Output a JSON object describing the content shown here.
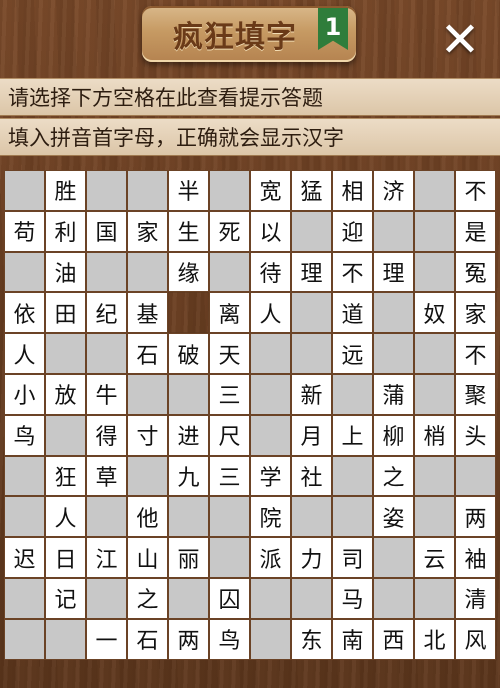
{
  "header": {
    "title": "疯狂填字",
    "level": "1",
    "close_icon": "close-icon"
  },
  "hints": {
    "line1": "请选择下方空格在此查看提示答题",
    "line2": "填入拼音首字母，正确就会显示汉字"
  },
  "grid": {
    "cols": 12,
    "legend": "E = no cell (wood), B = blank input cell (gray), other = filled character",
    "rows": [
      [
        "B",
        "胜",
        "B",
        "B",
        "半",
        "B",
        "宽",
        "猛",
        "相",
        "济",
        "B",
        "不"
      ],
      [
        "苟",
        "利",
        "国",
        "家",
        "生",
        "死",
        "以",
        "B",
        "迎",
        "B",
        "B",
        "是"
      ],
      [
        "B",
        "油",
        "B",
        "B",
        "缘",
        "B",
        "待",
        "理",
        "不",
        "理",
        "B",
        "冤"
      ],
      [
        "依",
        "田",
        "纪",
        "基",
        "E",
        "离",
        "人",
        "B",
        "道",
        "B",
        "奴",
        "家"
      ],
      [
        "人",
        "B",
        "B",
        "石",
        "破",
        "天",
        "B",
        "B",
        "远",
        "B",
        "B",
        "不"
      ],
      [
        "小",
        "放",
        "牛",
        "B",
        "B",
        "三",
        "B",
        "新",
        "B",
        "蒲",
        "B",
        "聚"
      ],
      [
        "鸟",
        "B",
        "得",
        "寸",
        "进",
        "尺",
        "B",
        "月",
        "上",
        "柳",
        "梢",
        "头"
      ],
      [
        "B",
        "狂",
        "草",
        "B",
        "九",
        "三",
        "学",
        "社",
        "B",
        "之",
        "B",
        "B"
      ],
      [
        "B",
        "人",
        "B",
        "他",
        "B",
        "B",
        "院",
        "B",
        "B",
        "姿",
        "B",
        "两"
      ],
      [
        "迟",
        "日",
        "江",
        "山",
        "丽",
        "B",
        "派",
        "力",
        "司",
        "B",
        "云",
        "袖"
      ],
      [
        "B",
        "记",
        "B",
        "之",
        "B",
        "囚",
        "B",
        "B",
        "马",
        "B",
        "B",
        "清"
      ],
      [
        "B",
        "B",
        "一",
        "石",
        "两",
        "鸟",
        "B",
        "东",
        "南",
        "西",
        "北",
        "风"
      ]
    ]
  }
}
